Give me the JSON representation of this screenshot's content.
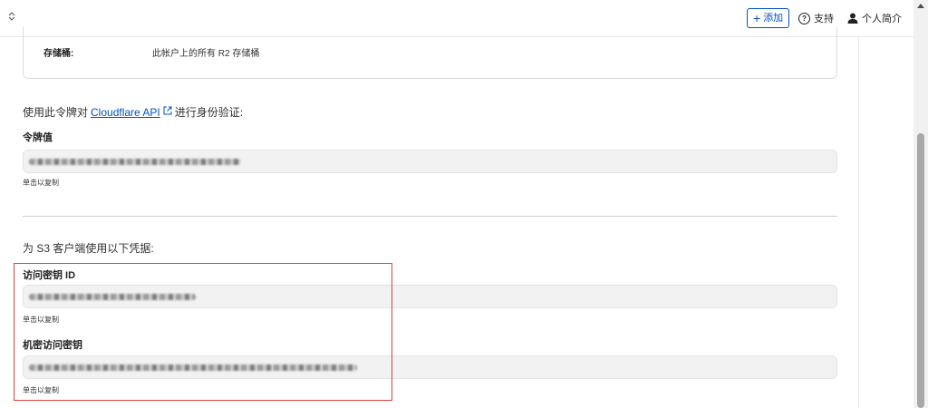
{
  "header": {
    "add_label": "添加",
    "support_label": "支持",
    "profile_label": "个人简介"
  },
  "bucket": {
    "label": "存储桶:",
    "value": "此帐户上的所有 R2 存储桶"
  },
  "auth": {
    "prefix": "使用此令牌对",
    "link_text": "Cloudflare API",
    "suffix": "进行身份验证:"
  },
  "token": {
    "label": "令牌值",
    "hint": "单击以复制"
  },
  "s3": {
    "heading": "为 S3 客户端使用以下凭据:",
    "access_key": {
      "label": "访问密钥 ID",
      "hint": "单击以复制"
    },
    "secret_key": {
      "label": "机密访问密钥",
      "hint": "单击以复制"
    }
  },
  "colors": {
    "accent": "#0051c3",
    "highlight": "#e0403a"
  },
  "icons": {
    "collapse": "chevron-updown-icon",
    "add": "plus-icon",
    "support": "question-circle-icon",
    "profile": "user-icon",
    "external": "external-link-icon"
  }
}
